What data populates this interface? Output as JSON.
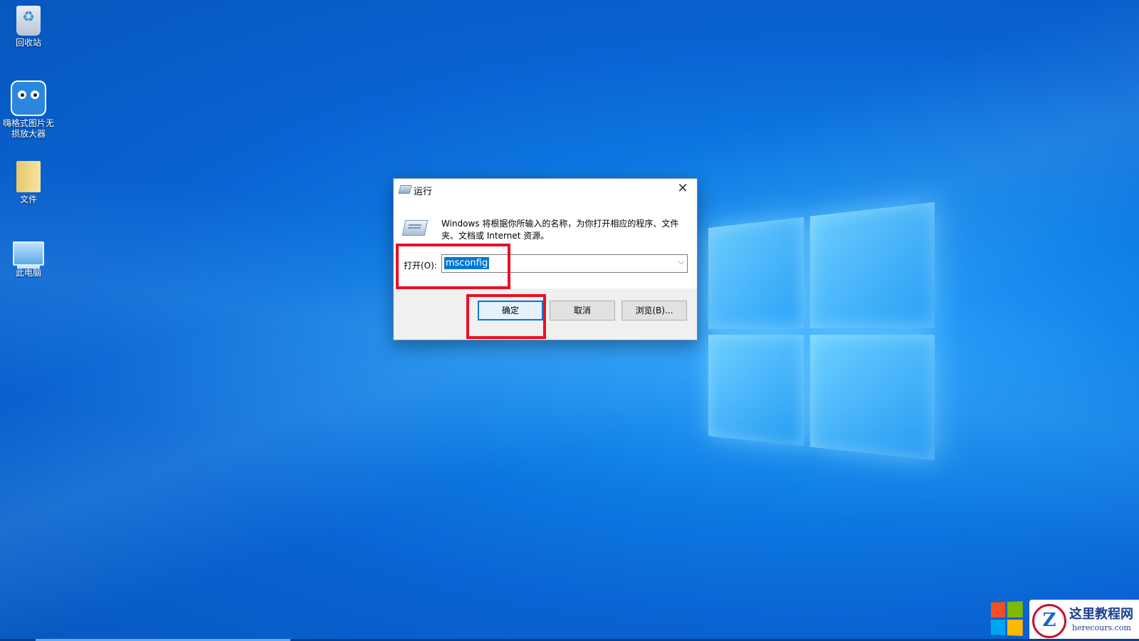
{
  "desktop": {
    "icons": [
      {
        "label": "回收站",
        "icon": "recycle-bin-icon"
      },
      {
        "label": "嗨格式图片无损放大器",
        "icon": "owl-app-icon"
      },
      {
        "label": "文件",
        "icon": "folder-icon"
      },
      {
        "label": "此电脑",
        "icon": "computer-icon"
      }
    ]
  },
  "run_dialog": {
    "title": "运行",
    "description": "Windows 将根据你所输入的名称，为你打开相应的程序、文件夹、文档或 Internet 资源。",
    "open_label": "打开(O):",
    "input_value": "msconfig",
    "buttons": {
      "ok": "确定",
      "cancel": "取消",
      "browse": "浏览(B)..."
    }
  },
  "watermark": {
    "title": "这里教程网",
    "url": "herecours.com"
  },
  "colors": {
    "highlight": "#e81123",
    "selection": "#0078d7"
  }
}
